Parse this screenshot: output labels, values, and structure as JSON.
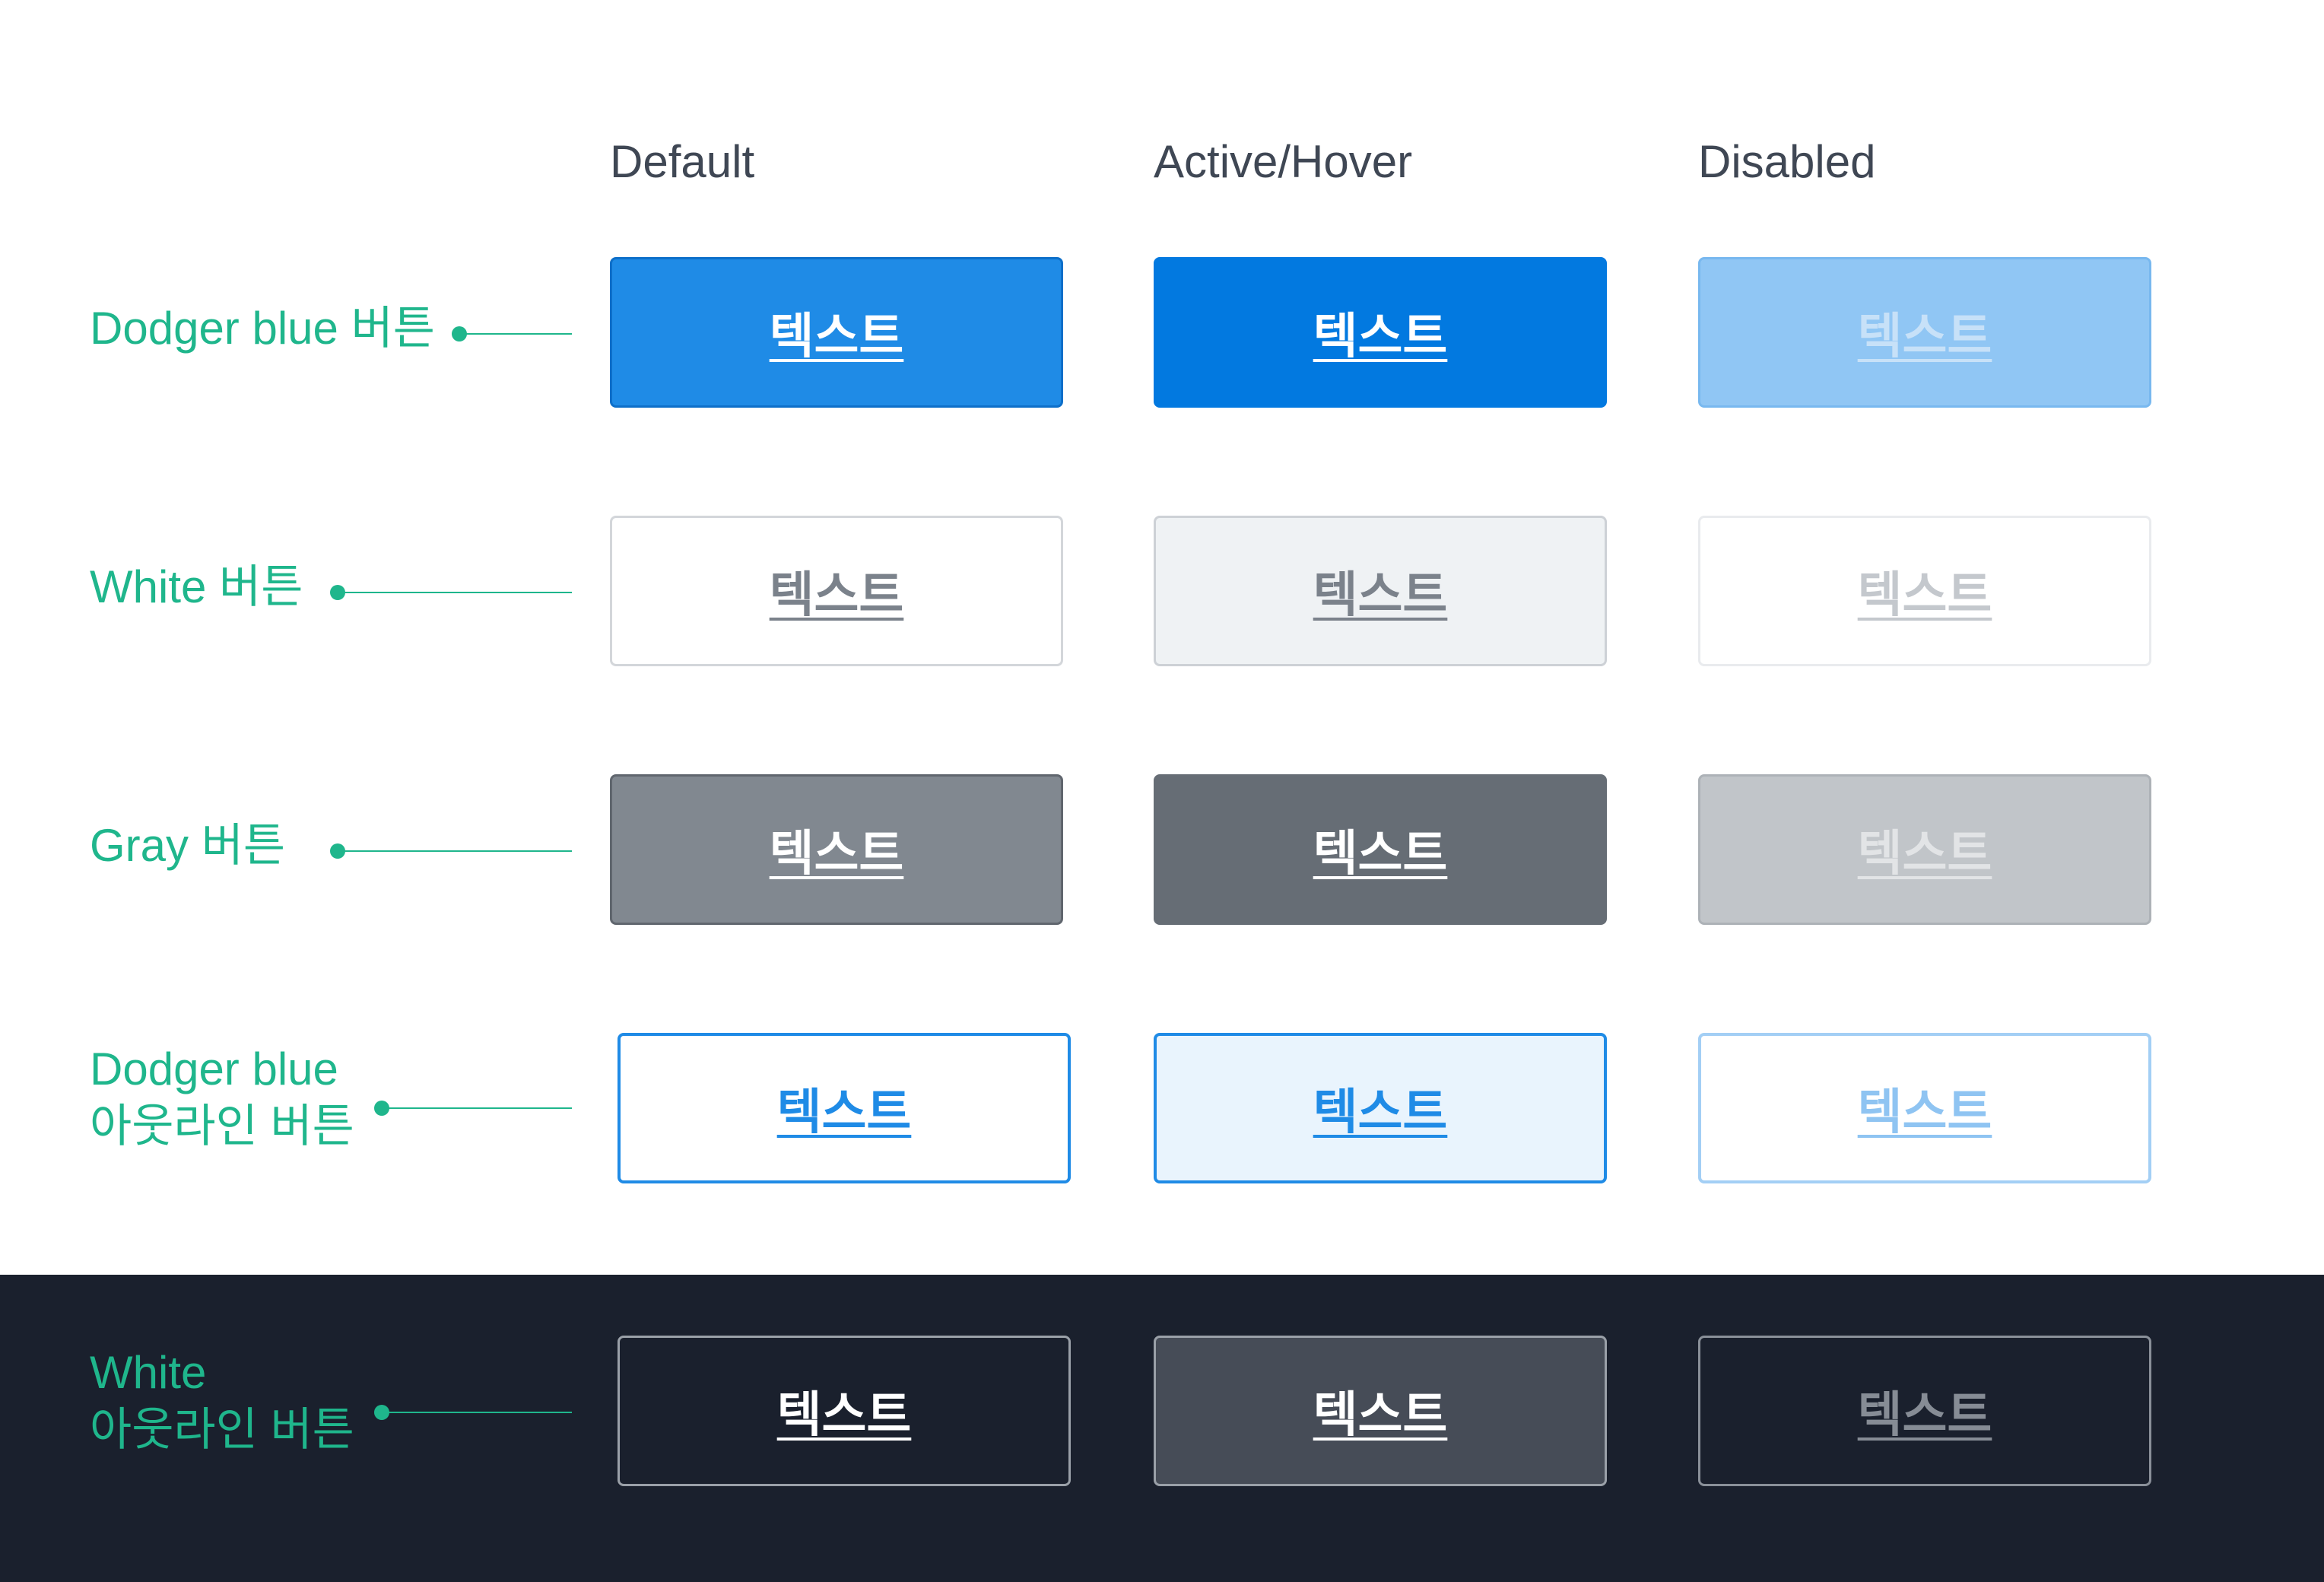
{
  "columns": {
    "default": "Default",
    "active": "Active/Hover",
    "disabled": "Disabled"
  },
  "rows": {
    "dodger_blue": {
      "label": "Dodger blue 버튼"
    },
    "white": {
      "label": "White 버튼"
    },
    "gray": {
      "label": "Gray 버튼"
    },
    "dodger_outline": {
      "label_line1": "Dodger blue",
      "label_line2": "아웃라인 버튼"
    },
    "white_outline": {
      "label_line1": "White",
      "label_line2": "아웃라인 버튼"
    }
  },
  "button_text": "텍스트",
  "colors": {
    "accent_green": "#1fb68c",
    "dodger_blue": "#1f8be6",
    "dodger_blue_active": "#0279e0",
    "dodger_blue_disabled": "#90c6f4",
    "gray": "#818890",
    "gray_active": "#666d75",
    "gray_disabled": "#c1c5c9",
    "dark_background": "#1a202d"
  }
}
